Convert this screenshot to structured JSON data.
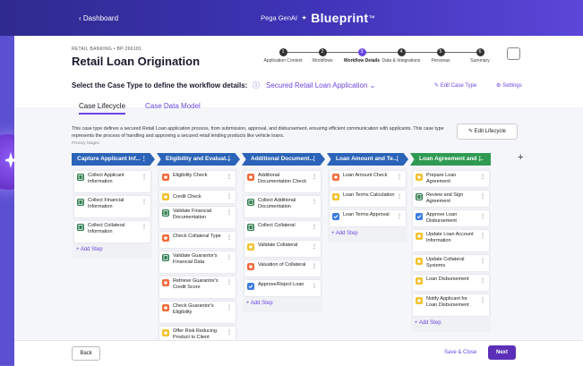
{
  "topbar": {
    "back_label": "‹  Dashboard",
    "brand_small": "Pega GenAI",
    "brand_big": "Blueprint",
    "brand_tm": "™"
  },
  "header": {
    "breadcrumb": "RETAIL BANKING • BP-266181",
    "title": "Retail Loan Origination"
  },
  "steps": [
    {
      "num": "1",
      "label": "Application Context",
      "active": false
    },
    {
      "num": "2",
      "label": "Workflows",
      "active": false
    },
    {
      "num": "3",
      "label": "Workflow Details",
      "active": true
    },
    {
      "num": "4",
      "label": "Data & Integrations",
      "active": false
    },
    {
      "num": "5",
      "label": "Personas",
      "active": false
    },
    {
      "num": "6",
      "label": "Summary",
      "active": false
    }
  ],
  "select_row": {
    "label": "Select the Case Type to define the workflow details:",
    "selected": "Secured Retail Loan Application",
    "edit_label": "Edit Case Type",
    "settings_label": "Settings"
  },
  "tabs": [
    {
      "label": "Case Lifecycle"
    },
    {
      "label": "Case Data Model"
    }
  ],
  "description": "This case type defines a secured Retail Loan application process, from submission, approval, and disbursement, ensuring efficient communication with applicants. This case type represents the process of handling and approving a secured retail lending products like vehicle loans.",
  "primary_stages_label": "Primary Stages",
  "edit_lifecycle_label": "Edit Lifecycle",
  "add_step_label": "+  Add Step",
  "stages": [
    {
      "title": "Capture Applicant Inf...",
      "color": "#2a63b8",
      "items": [
        {
          "text": "Collect Applicant Information",
          "icon": "green"
        },
        {
          "text": "Collect Financial Information",
          "icon": "green"
        },
        {
          "text": "Collect Collateral Information",
          "icon": "green"
        }
      ]
    },
    {
      "title": "Eligibility and Evaluat...",
      "color": "#2a63b8",
      "items": [
        {
          "text": "Eligibility Check",
          "icon": "orange"
        },
        {
          "text": "Credit Check",
          "icon": "yellow"
        },
        {
          "text": "Validate Financial Documentation",
          "icon": "green"
        },
        {
          "text": "Check Collateral Type",
          "icon": "orange"
        },
        {
          "text": "Validate Guarantor's Financial Data",
          "icon": "green"
        },
        {
          "text": "Retrieve Guarantor's Credit Score",
          "icon": "orange"
        },
        {
          "text": "Check Guarantor's Eligibility",
          "icon": "orange"
        },
        {
          "text": "Offer Risk Reducing Product to Client",
          "icon": "yellow"
        }
      ]
    },
    {
      "title": "Additional Document...",
      "color": "#2a63b8",
      "items": [
        {
          "text": "Additional Documentation Check",
          "icon": "orange"
        },
        {
          "text": "Collect Additional Documentation",
          "icon": "green"
        },
        {
          "text": "Collect Collateral",
          "icon": "green"
        },
        {
          "text": "Validate Collateral",
          "icon": "yellow"
        },
        {
          "text": "Valuation of Collateral",
          "icon": "orange"
        },
        {
          "text": "Approve/Reject Loan",
          "icon": "blue"
        }
      ]
    },
    {
      "title": "Loan Amount and Te...",
      "color": "#2a63b8",
      "items": [
        {
          "text": "Loan Amount Check",
          "icon": "orange"
        },
        {
          "text": "Loan Terms Calculation",
          "icon": "yellow"
        },
        {
          "text": "Loan Terms Approval",
          "icon": "blue"
        }
      ]
    },
    {
      "title": "Loan Agreement and ...",
      "color": "#2e9a52",
      "items": [
        {
          "text": "Prepare Loan Agreement",
          "icon": "yellow"
        },
        {
          "text": "Review and Sign Agreement",
          "icon": "green"
        },
        {
          "text": "Approve Loan Disbursement",
          "icon": "blue"
        },
        {
          "text": "Update Loan Account Information",
          "icon": "yellow"
        },
        {
          "text": "Update Collateral Systems",
          "icon": "yellow"
        },
        {
          "text": "Loan Disbursement",
          "icon": "yellow"
        },
        {
          "text": "Notify Applicant for Loan Disbursement",
          "icon": "yellow"
        }
      ]
    }
  ],
  "footer": {
    "back_label": "Back",
    "save_label": "Save & Close",
    "next_label": "Next"
  }
}
